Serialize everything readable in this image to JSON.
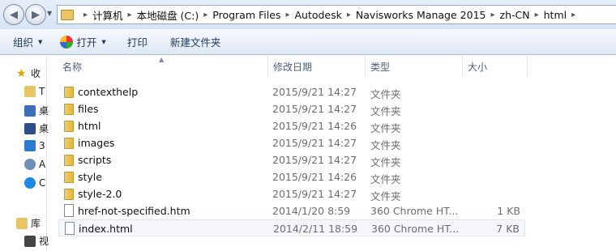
{
  "address": {
    "crumbs": [
      "计算机",
      "本地磁盘 (C:)",
      "Program Files",
      "Autodesk",
      "Navisworks Manage 2015",
      "zh-CN",
      "html"
    ]
  },
  "toolbar": {
    "organize": "组织",
    "open": "打开",
    "print": "打印",
    "new_folder": "新建文件夹"
  },
  "nav": {
    "favorites": "收",
    "fav_items": [
      "T",
      "桌",
      "桌",
      "3",
      "A",
      "C"
    ],
    "library": "库",
    "lib_items": [
      "视"
    ]
  },
  "columns": {
    "name": "名称",
    "modified": "修改日期",
    "type": "类型",
    "size": "大小"
  },
  "files": [
    {
      "name": "contexthelp",
      "modified": "2015/9/21 14:27",
      "type": "文件夹",
      "size": "",
      "kind": "folder"
    },
    {
      "name": "files",
      "modified": "2015/9/21 14:27",
      "type": "文件夹",
      "size": "",
      "kind": "folder"
    },
    {
      "name": "html",
      "modified": "2015/9/21 14:26",
      "type": "文件夹",
      "size": "",
      "kind": "folder"
    },
    {
      "name": "images",
      "modified": "2015/9/21 14:27",
      "type": "文件夹",
      "size": "",
      "kind": "folder"
    },
    {
      "name": "scripts",
      "modified": "2015/9/21 14:27",
      "type": "文件夹",
      "size": "",
      "kind": "folder"
    },
    {
      "name": "style",
      "modified": "2015/9/21 14:26",
      "type": "文件夹",
      "size": "",
      "kind": "folder"
    },
    {
      "name": "style-2.0",
      "modified": "2015/9/21 14:27",
      "type": "文件夹",
      "size": "",
      "kind": "folder"
    },
    {
      "name": "href-not-specified.htm",
      "modified": "2014/1/20 8:59",
      "type": "360 Chrome HT...",
      "size": "1 KB",
      "kind": "file"
    },
    {
      "name": "index.html",
      "modified": "2014/2/11 18:59",
      "type": "360 Chrome HT...",
      "size": "7 KB",
      "kind": "file"
    }
  ]
}
